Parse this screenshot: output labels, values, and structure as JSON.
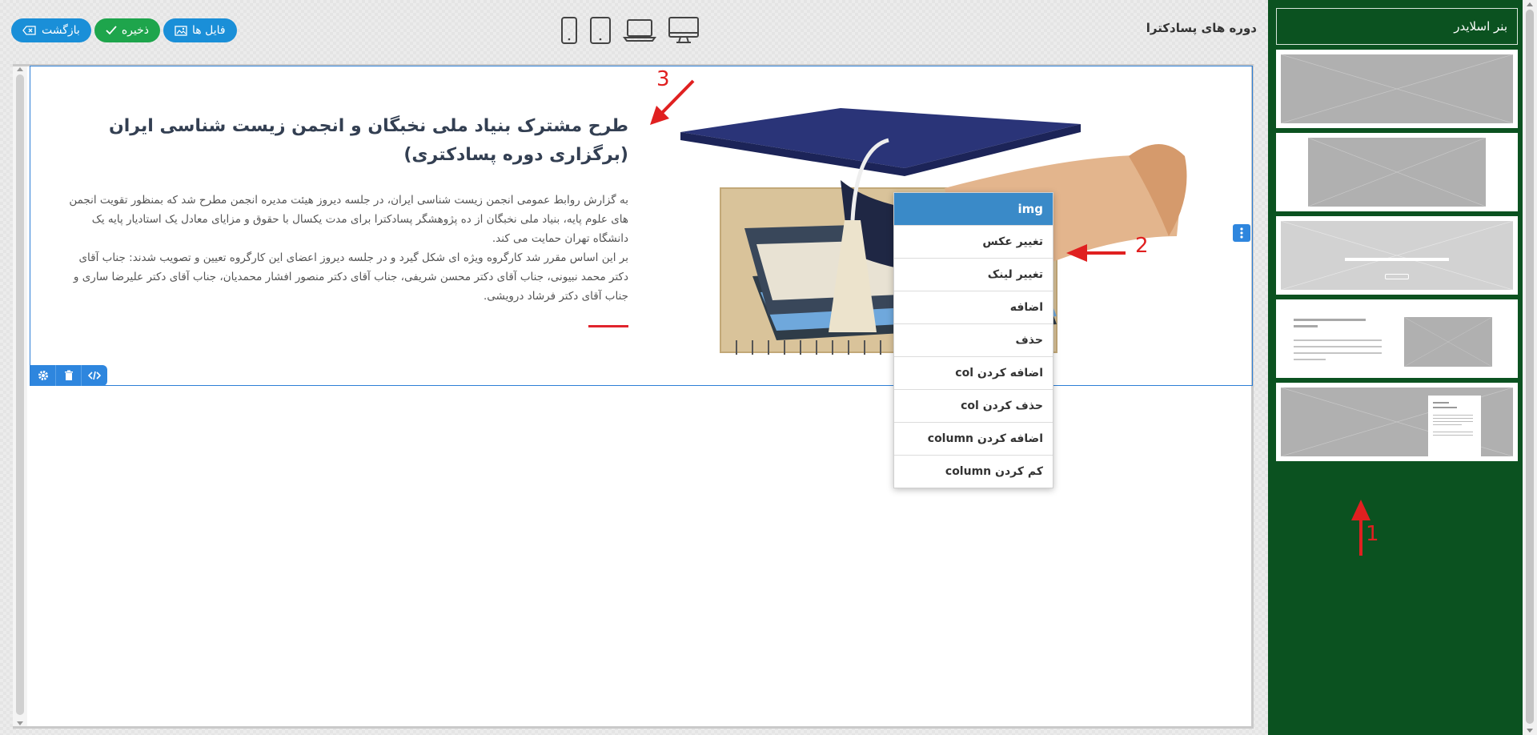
{
  "header": {
    "page_title": "دوره های پسادکترا",
    "buttons": {
      "back": "بازگشت",
      "save": "ذخیره",
      "files": "فایل ها"
    },
    "devices": [
      "desktop-icon",
      "laptop-icon",
      "tablet-icon",
      "mobile-icon"
    ]
  },
  "sidebar": {
    "title": "بنر اسلایدر",
    "templates": [
      "banner-full-image",
      "banner-centered-image",
      "banner-text-centered",
      "banner-text-image",
      "banner-image-document"
    ]
  },
  "section": {
    "title": "طرح مشترک بنیاد ملی نخبگان و انجمن زیست شناسی ایران (برگزاری دوره پسادکتری)",
    "body_line1": "به گزارش روابط عمومی انجمن زیست شناسی ایران، در جلسه دیروز هیئت مدیره انجمن مطرح شد که بمنظور تقویت انجمن های علوم پایه، بنیاد ملی نخبگان از ده پژوهشگر پسادکترا برای مدت یکسال با حقوق و مزایای معادل یک استادیار پایه یک دانشگاه تهران حمایت می کند.",
    "body_line2": "بر این اساس مقرر شد کارگروه ویژه ای شکل گیرد و در جلسه دیروز اعضای این کارگروه تعیین و تصویب شدند: جناب آقای دکتر محمد نبیونی، جناب آقای دکتر محسن شریفی، جناب آقای دکتر منصور افشار محمدیان، جناب آقای دکتر علیرضا ساری و جناب آقای دکتر فرشاد درویشی."
  },
  "context_menu": {
    "title": "img",
    "items": [
      "تغییر عکس",
      "تغییر لینک",
      "اضافه",
      "حذف",
      "اضافه کردن col",
      "حذف کردن col",
      "اضافه کردن column",
      "کم کردن column"
    ]
  },
  "annotations": [
    "1",
    "2",
    "3"
  ],
  "colors": {
    "sidebar_bg": "#0b5220",
    "accent_blue": "#1a8fd8",
    "save_green": "#1ea54c",
    "annotation_red": "#e02020"
  }
}
